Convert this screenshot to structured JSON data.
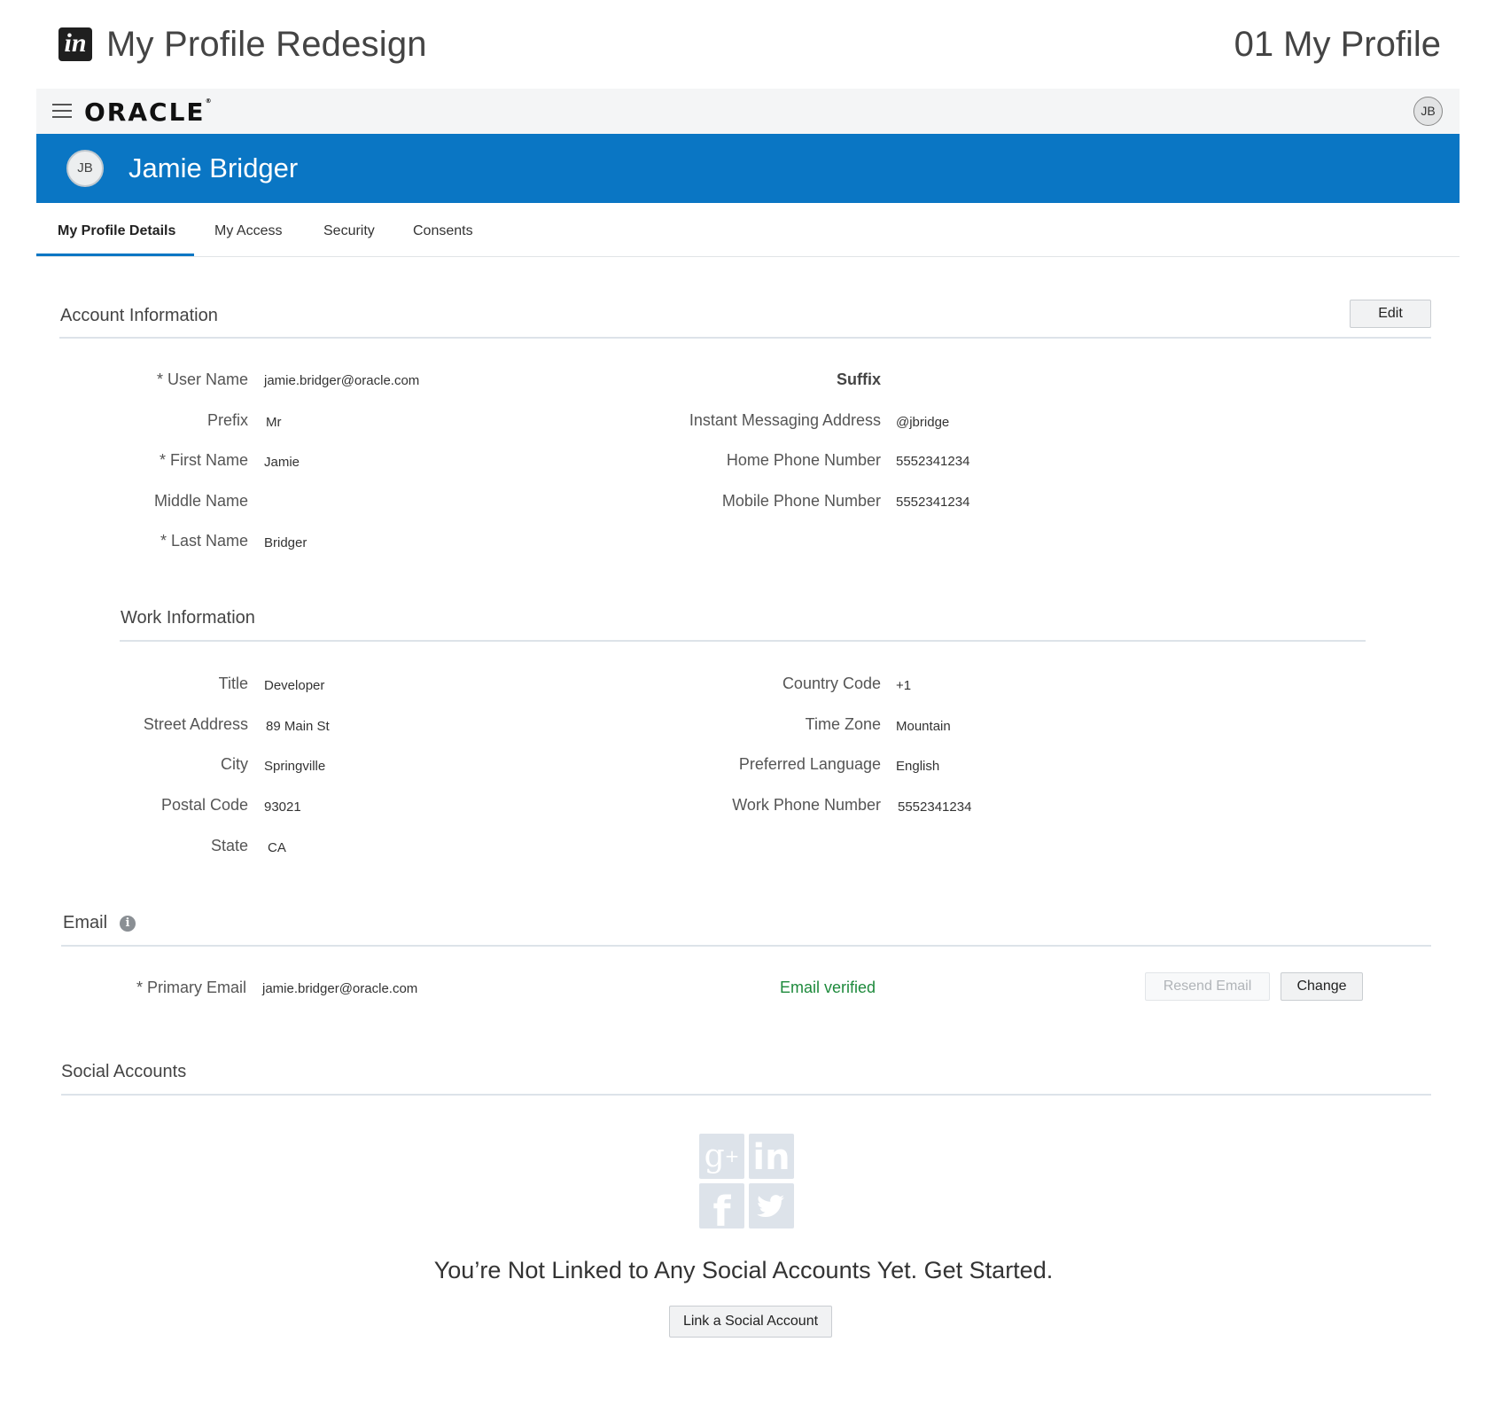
{
  "project": {
    "logo_text": "in",
    "title": "My Profile Redesign",
    "screen_name": "01 My Profile"
  },
  "header": {
    "brand": "ORACLE",
    "avatar_initials": "JB"
  },
  "banner": {
    "avatar_initials": "JB",
    "user_name": "Jamie Bridger"
  },
  "tabs": [
    {
      "label": "My Profile Details",
      "active": true
    },
    {
      "label": "My Access",
      "active": false
    },
    {
      "label": "Security",
      "active": false
    },
    {
      "label": "Consents",
      "active": false
    }
  ],
  "account": {
    "title": "Account Information",
    "edit_label": "Edit",
    "left": [
      {
        "label": "* User Name",
        "value": "jamie.bridger@oracle.com"
      },
      {
        "label": "Prefix",
        "value": "Mr"
      },
      {
        "label": "* First Name",
        "value": "Jamie"
      },
      {
        "label": "Middle Name",
        "value": ""
      },
      {
        "label": "* Last Name",
        "value": "Bridger"
      }
    ],
    "right": [
      {
        "label": "Suffix",
        "value": ""
      },
      {
        "label": "Instant Messaging Address",
        "value": "@jbridge"
      },
      {
        "label": "Home Phone Number",
        "value": "5552341234"
      },
      {
        "label": "Mobile Phone Number",
        "value": "5552341234"
      }
    ]
  },
  "work": {
    "title": "Work Information",
    "left": [
      {
        "label": "Title",
        "value": "Developer"
      },
      {
        "label": "Street Address",
        "value": "89 Main St"
      },
      {
        "label": "City",
        "value": "Springville"
      },
      {
        "label": "Postal Code",
        "value": "93021"
      },
      {
        "label": "State",
        "value": "CA"
      }
    ],
    "right": [
      {
        "label": "Country Code",
        "value": "+1"
      },
      {
        "label": "Time Zone",
        "value": "Mountain"
      },
      {
        "label": "Preferred Language",
        "value": "English"
      },
      {
        "label": "Work Phone Number",
        "value": "5552341234"
      }
    ]
  },
  "email": {
    "title": "Email",
    "primary_label": "* Primary Email",
    "primary_value": "jamie.bridger@oracle.com",
    "status": "Email verified",
    "resend_label": "Resend Email",
    "change_label": "Change"
  },
  "social": {
    "title": "Social Accounts",
    "icons": [
      "google-plus-icon",
      "linkedin-icon",
      "facebook-icon",
      "twitter-icon"
    ],
    "empty_message": "You’re Not Linked to Any Social Accounts Yet. Get Started.",
    "link_label": "Link a Social Account"
  },
  "colors": {
    "banner": "#0a76c4",
    "verified": "#1e8a3c"
  }
}
